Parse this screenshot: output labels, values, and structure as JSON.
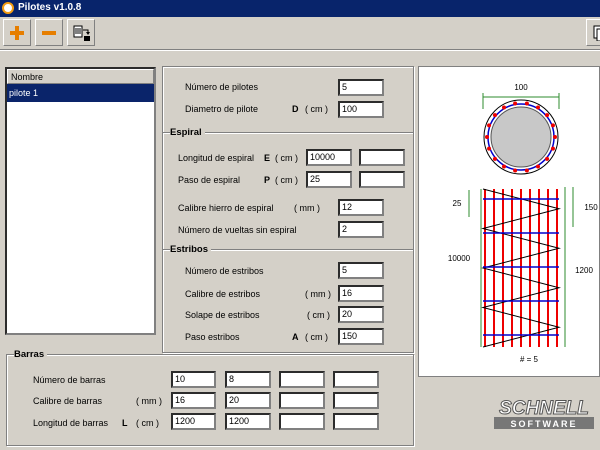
{
  "window": {
    "title": "Pilotes   v1.0.8"
  },
  "toolbar": {
    "add_icon": "plus-icon",
    "remove_icon": "minus-icon",
    "export_icon": "export-icon",
    "right_icon": "copy-icon"
  },
  "list": {
    "header": "Nombre",
    "items": [
      "pilote 1"
    ]
  },
  "general": {
    "num_pilotes_label": "Número de pilotes",
    "num_pilotes": "5",
    "diametro_label": "Diametro de pilote",
    "diametro_sym": "D",
    "diametro_unit": "( cm )",
    "diametro": "100"
  },
  "espiral": {
    "title": "Espiral",
    "longitud_label": "Longitud de espiral",
    "longitud_sym": "E",
    "longitud_unit": "( cm )",
    "longitud": "10000",
    "paso_label": "Paso de espiral",
    "paso_sym": "P",
    "paso_unit": "( cm )",
    "paso": "25",
    "calibre_label": "Calibre hierro de espiral",
    "calibre_unit": "( mm )",
    "calibre": "12",
    "vueltas_label": "Número de vueltas sin espiral",
    "vueltas": "2"
  },
  "estribos": {
    "title": "Estribos",
    "numero_label": "Número de estribos",
    "numero": "5",
    "calibre_label": "Calibre de estribos",
    "calibre_unit": "( mm )",
    "calibre": "16",
    "solape_label": "Solape de estribos",
    "solape_unit": "( cm )",
    "solape": "20",
    "paso_label": "Paso estribos",
    "paso_sym": "A",
    "paso_unit": "( cm )",
    "paso": "150"
  },
  "barras": {
    "title": "Barras",
    "numero_label": "Número de barras",
    "numero": [
      "10",
      "8",
      "",
      ""
    ],
    "calibre_label": "Calibre de barras",
    "calibre_unit": "( mm )",
    "calibre": [
      "16",
      "20",
      "",
      ""
    ],
    "longitud_label": "Longitud de barras",
    "longitud_sym": "L",
    "longitud_unit": "( cm )",
    "longitud": [
      "1200",
      "1200",
      "",
      ""
    ]
  },
  "drawing": {
    "diam": "100",
    "paso": "25",
    "longitud": "10000",
    "estribo_paso": "150",
    "barra_long": "1200",
    "count": "# = 5"
  },
  "logo": {
    "line1": "SCHNELL",
    "line2": "SOFTWARE"
  }
}
